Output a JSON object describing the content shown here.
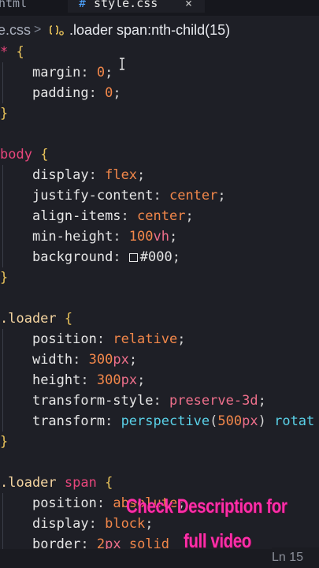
{
  "tabs": {
    "inactive_label": "html",
    "active_icon": "#",
    "active_label": "style.css",
    "close_glyph": "×"
  },
  "breadcrumb": {
    "file": "e.css",
    "separator": ">",
    "symbol_icon": "css-selector-icon",
    "selector": ".loader span:nth-child(15)"
  },
  "code": {
    "universal": {
      "selector": "*",
      "brace_open": "{",
      "brace_close": "}",
      "decls": [
        {
          "prop": "margin",
          "value": "0"
        },
        {
          "prop": "padding",
          "value": "0"
        }
      ]
    },
    "body": {
      "selector": "body",
      "brace_open": "{",
      "brace_close": "}",
      "display": {
        "prop": "display",
        "value": "flex"
      },
      "justify": {
        "prop": "justify-content",
        "value": "center"
      },
      "align": {
        "prop": "align-items",
        "value": "center"
      },
      "minh": {
        "prop": "min-height",
        "num": "100",
        "unit": "vh"
      },
      "bg": {
        "prop": "background",
        "value": "#000"
      }
    },
    "loader": {
      "selector": ".loader",
      "brace_open": "{",
      "brace_close": "}",
      "position": {
        "prop": "position",
        "value": "relative"
      },
      "width": {
        "prop": "width",
        "num": "300",
        "unit": "px"
      },
      "height": {
        "prop": "height",
        "num": "300",
        "unit": "px"
      },
      "tstyle": {
        "prop": "transform-style",
        "value": "preserve-3d"
      },
      "transform": {
        "prop": "transform",
        "fn": "perspective",
        "num": "500",
        "unit": "px",
        "rest": "rotat"
      }
    },
    "loader_span": {
      "selector": ".loader",
      "selector_tag": "span",
      "brace_open": "{",
      "position": {
        "prop": "position",
        "value": "absolute"
      },
      "display": {
        "prop": "display",
        "value": "block"
      },
      "border": {
        "prop": "border",
        "num": "2",
        "unit": "px",
        "value": "solid"
      }
    }
  },
  "overlay": {
    "line1": "Check Description for",
    "line2": "full video"
  },
  "status": {
    "position": "Ln 15"
  },
  "colors": {
    "editor_bg": "#1e1f26",
    "cta": "#ff2ea8"
  }
}
